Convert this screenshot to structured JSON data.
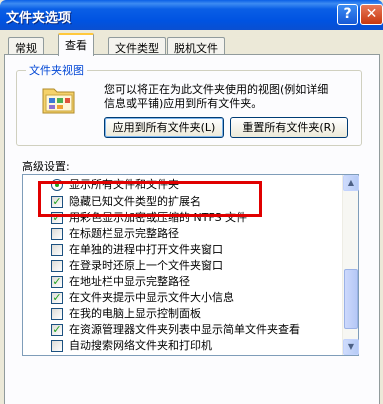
{
  "window": {
    "title": "文件夹选项",
    "help_label": "?",
    "close_label": "✕"
  },
  "tabs": [
    {
      "label": "常规",
      "active": false
    },
    {
      "label": "查看",
      "active": true
    },
    {
      "label": "文件类型",
      "active": false
    },
    {
      "label": "脱机文件",
      "active": false
    }
  ],
  "folder_views": {
    "title": "文件夹视图",
    "description": "您可以将正在为此文件夹使用的视图(例如详细\n信息或平铺)应用到所有文件夹。",
    "apply_button": "应用到所有文件夹(L)",
    "reset_button": "重置所有文件夹(R)",
    "icon": "folder-view-icon"
  },
  "advanced": {
    "label": "高级设置:",
    "items": [
      {
        "type": "radio",
        "checked": true,
        "label": "显示所有文件和文件夹"
      },
      {
        "type": "checkbox",
        "checked": true,
        "label": "隐藏已知文件类型的扩展名"
      },
      {
        "type": "checkbox",
        "checked": true,
        "label": "用彩色显示加密或压缩的 NTFS 文件"
      },
      {
        "type": "checkbox",
        "checked": false,
        "label": "在标题栏显示完整路径"
      },
      {
        "type": "checkbox",
        "checked": false,
        "label": "在单独的进程中打开文件夹窗口"
      },
      {
        "type": "checkbox",
        "checked": false,
        "label": "在登录时还原上一个文件夹窗口"
      },
      {
        "type": "checkbox",
        "checked": true,
        "label": "在地址栏中显示完整路径"
      },
      {
        "type": "checkbox",
        "checked": true,
        "label": "在文件夹提示中显示文件大小信息"
      },
      {
        "type": "checkbox",
        "checked": false,
        "label": "在我的电脑上显示控制面板"
      },
      {
        "type": "checkbox",
        "checked": true,
        "label": "在资源管理器文件夹列表中显示简单文件夹查看"
      },
      {
        "type": "checkbox",
        "checked": false,
        "label": "自动搜索网络文件夹和打印机"
      }
    ]
  },
  "colors": {
    "titlebar": "#0a5fe6",
    "highlight": "#e00000",
    "check": "#21a121"
  }
}
